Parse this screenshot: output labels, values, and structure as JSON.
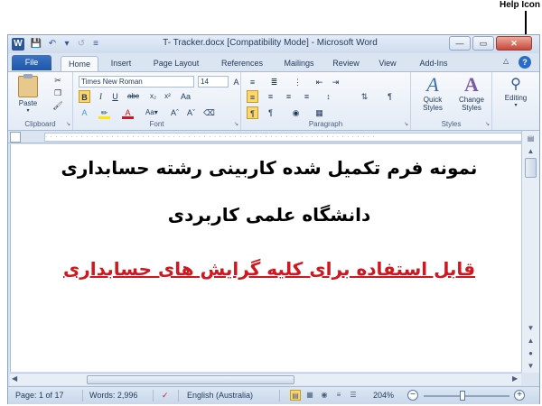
{
  "annotation": {
    "help_label": "Help Icon"
  },
  "titlebar": {
    "app_icon": "W",
    "title": "T- Tracker.docx [Compatibility Mode] - Microsoft Word",
    "save_icon": "save-icon",
    "undo_icon": "undo-icon",
    "redo_icon": "redo-icon"
  },
  "tabs": {
    "file": "File",
    "items": [
      "Home",
      "Insert",
      "Page Layout",
      "References",
      "Mailings",
      "Review",
      "View",
      "Add-Ins"
    ],
    "help": "?"
  },
  "ribbon": {
    "clipboard": {
      "label": "Clipboard",
      "paste": "Paste"
    },
    "font": {
      "label": "Font",
      "font_name": "Times New Roman",
      "font_size": "14"
    },
    "paragraph": {
      "label": "Paragraph"
    },
    "styles": {
      "label": "Styles",
      "quick_styles": "Quick Styles",
      "change_styles": "Change Styles"
    },
    "editing": {
      "label": "Editing"
    }
  },
  "document": {
    "line1": "نمونه فرم تکمیل شده کاربینی رشته حسابداری",
    "line2": "دانشگاه علمی کاربردی",
    "line3": "قابل استفاده برای کلیه گرایش های حسابداری"
  },
  "status": {
    "page": "Page: 1 of 17",
    "words": "Words: 2,996",
    "language": "English (Australia)",
    "zoom": "204%",
    "zoom_level_percent": 204
  },
  "colors": {
    "accent": "#2b579a",
    "doc_red": "#d0161e"
  }
}
